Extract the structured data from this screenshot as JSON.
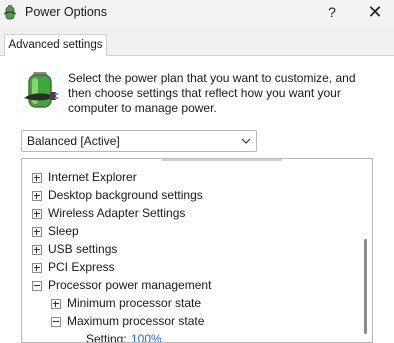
{
  "window": {
    "title": "Power Options",
    "help_label": "?",
    "close_label": "✕"
  },
  "tab": {
    "label": "Advanced settings"
  },
  "description": "Select the power plan that you want to customize, and then choose settings that reflect how you want your computer to manage power.",
  "plan": {
    "selected": "Balanced [Active]"
  },
  "tree": {
    "items": [
      {
        "label": "Internet Explorer",
        "state": "collapsed"
      },
      {
        "label": "Desktop background settings",
        "state": "collapsed"
      },
      {
        "label": "Wireless Adapter Settings",
        "state": "collapsed"
      },
      {
        "label": "Sleep",
        "state": "collapsed"
      },
      {
        "label": "USB settings",
        "state": "collapsed"
      },
      {
        "label": "PCI Express",
        "state": "collapsed"
      },
      {
        "label": "Processor power management",
        "state": "expanded"
      },
      {
        "label": "Minimum processor state",
        "state": "collapsed"
      },
      {
        "label": "Maximum processor state",
        "state": "expanded"
      }
    ],
    "setting": {
      "label": "Setting:",
      "value": "100%"
    }
  },
  "colors": {
    "link_blue": "#1a6fd8",
    "title_bg": "#f3f3f3",
    "battery_green": "#3aa83a"
  }
}
